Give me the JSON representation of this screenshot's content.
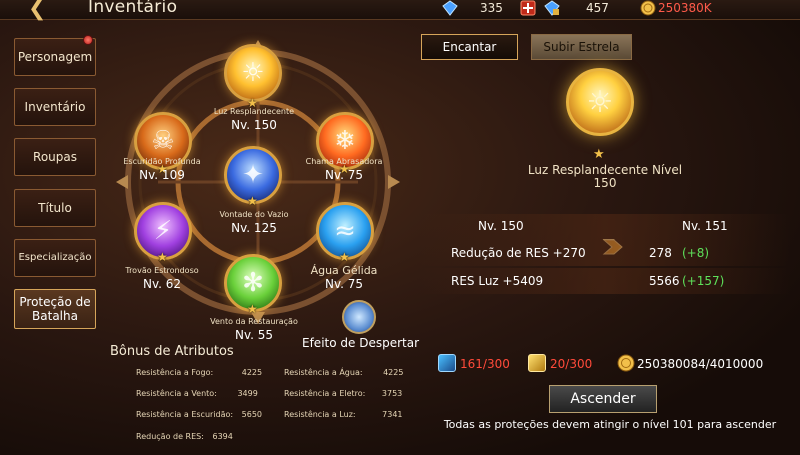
{
  "header": {
    "title": "Inventário",
    "gems": "335",
    "premium": "457",
    "gold": "250380K"
  },
  "nav": [
    {
      "label": "Personagem"
    },
    {
      "label": "Inventário"
    },
    {
      "label": "Roupas"
    },
    {
      "label": "Título"
    },
    {
      "label": "Especialização"
    },
    {
      "label": "Proteção de Batalha"
    }
  ],
  "wheel": {
    "orbs": [
      {
        "name": "Luz Resplandecente",
        "level": "Nv. 150",
        "color": "#ffc030"
      },
      {
        "name": "Escuridão Profunda",
        "level": "Nv. 109",
        "color": "#d86a1a"
      },
      {
        "name": "Chama Abrasadora",
        "level": "Nv. 75",
        "color": "#ff6a20"
      },
      {
        "name": "Vontade do Vazio",
        "level": "Nv. 125",
        "color": "#3a6ae0"
      },
      {
        "name": "Trovão Estrondoso",
        "level": "Nv. 62",
        "color": "#a040e0"
      },
      {
        "name": "Água Gélida",
        "level": "Nv. 75",
        "color": "#2aa0f0"
      },
      {
        "name": "Vento da Restauração",
        "level": "Nv. 55",
        "color": "#6ad03a"
      }
    ],
    "effect_label": "Efeito de Despertar"
  },
  "bonus": {
    "title": "Bônus de Atributos",
    "items": [
      {
        "label": "Resistência a Fogo:",
        "value": "4225"
      },
      {
        "label": "Resistência a Água:",
        "value": "4225"
      },
      {
        "label": "Resistência a Vento:",
        "value": "3499"
      },
      {
        "label": "Resistência a Eletro:",
        "value": "3753"
      },
      {
        "label": "Resistência a Escuridão:",
        "value": "5650"
      },
      {
        "label": "Resistência a Luz:",
        "value": "7341"
      },
      {
        "label": "Redução de RES:",
        "value": "6394"
      }
    ]
  },
  "tabs": {
    "active": "Encantar",
    "inactive": "Subir Estrela"
  },
  "detail": {
    "name": "Luz Resplandecente Nível",
    "level": "150",
    "current_level": "Nv. 150",
    "next_level": "Nv. 151",
    "stats": [
      {
        "label": "Redução de RES +270",
        "next": "278",
        "gain": "(+8)"
      },
      {
        "label": "RES Luz +5409",
        "next": "5566",
        "gain": "(+157)"
      }
    ]
  },
  "cost": {
    "item1": "161/300",
    "item2": "20/300",
    "gold": "250380084/4010000"
  },
  "ascend": {
    "button": "Ascender",
    "note": "Todas as proteções devem atingir o nível 101 para ascender"
  }
}
